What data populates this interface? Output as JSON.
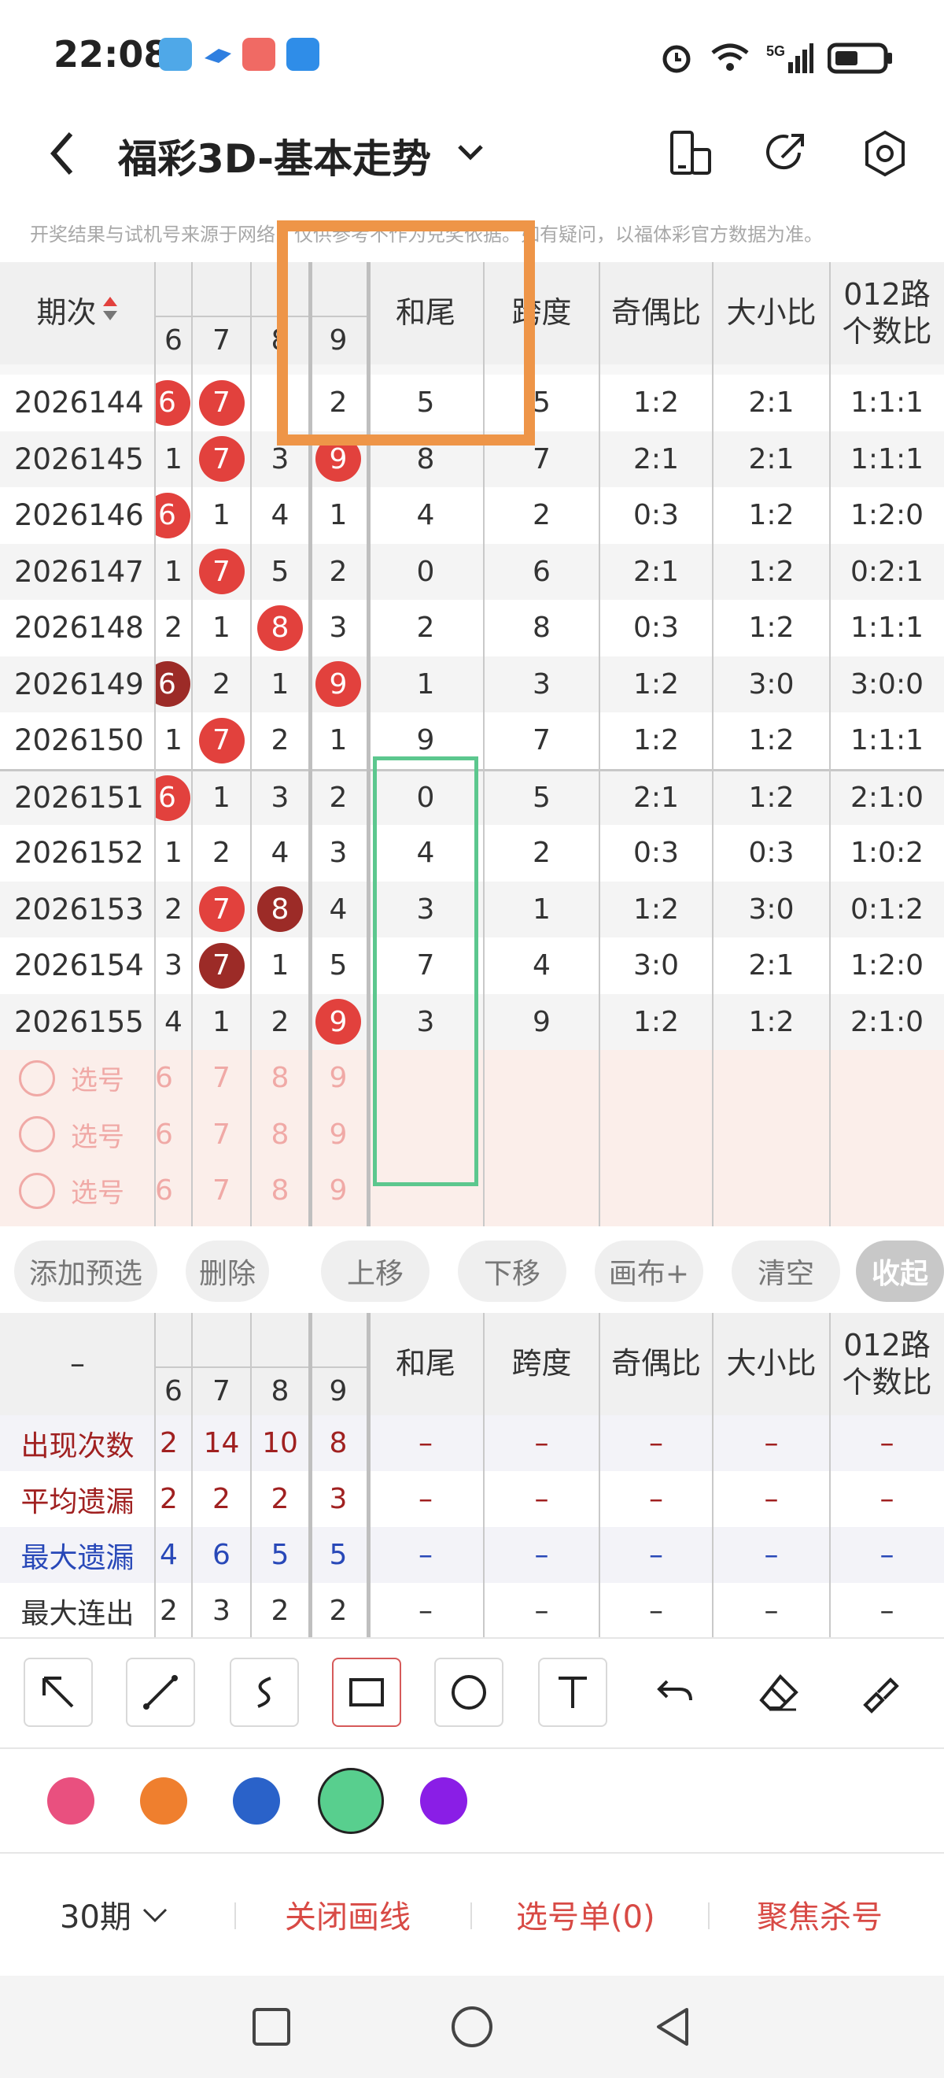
{
  "status": {
    "time": "22:08"
  },
  "header": {
    "title": "福彩3D-基本走势"
  },
  "notice": "开奖结果与试机号来源于网络，仅供参考不作为兑奖依据。如有疑问，以福体彩官方数据为准。",
  "table": {
    "period_label": "期次",
    "digit_labels": [
      "6",
      "7",
      "8",
      "9"
    ],
    "columns": [
      "和尾",
      "跨度",
      "奇偶比",
      "大小比"
    ],
    "route_label": [
      "012路",
      "个数比"
    ],
    "rows": [
      {
        "period": "2026144",
        "d": [
          "6",
          "7",
          "",
          "2"
        ],
        "hw": "5",
        "kd": "5",
        "jo": "1:2",
        "dx": "2:1",
        "lu": "1:1:1"
      },
      {
        "period": "2026145",
        "d": [
          "1",
          "7",
          "3",
          "9"
        ],
        "hw": "8",
        "kd": "7",
        "jo": "2:1",
        "dx": "2:1",
        "lu": "1:1:1"
      },
      {
        "period": "2026146",
        "d": [
          "6",
          "1",
          "4",
          "1"
        ],
        "hw": "4",
        "kd": "2",
        "jo": "0:3",
        "dx": "1:2",
        "lu": "1:2:0"
      },
      {
        "period": "2026147",
        "d": [
          "1",
          "7",
          "5",
          "2"
        ],
        "hw": "0",
        "kd": "6",
        "jo": "2:1",
        "dx": "1:2",
        "lu": "0:2:1"
      },
      {
        "period": "2026148",
        "d": [
          "2",
          "1",
          "8",
          "3"
        ],
        "hw": "2",
        "kd": "8",
        "jo": "0:3",
        "dx": "1:2",
        "lu": "1:1:1"
      },
      {
        "period": "2026149",
        "d": [
          "6",
          "2",
          "1",
          "9"
        ],
        "hw": "1",
        "kd": "3",
        "jo": "1:2",
        "dx": "3:0",
        "lu": "3:0:0"
      },
      {
        "period": "2026150",
        "d": [
          "1",
          "7",
          "2",
          "1"
        ],
        "hw": "9",
        "kd": "7",
        "jo": "1:2",
        "dx": "1:2",
        "lu": "1:1:1"
      },
      {
        "period": "2026151",
        "d": [
          "6",
          "1",
          "3",
          "2"
        ],
        "hw": "0",
        "kd": "5",
        "jo": "2:1",
        "dx": "1:2",
        "lu": "2:1:0"
      },
      {
        "period": "2026152",
        "d": [
          "1",
          "2",
          "4",
          "3"
        ],
        "hw": "4",
        "kd": "2",
        "jo": "0:3",
        "dx": "0:3",
        "lu": "1:0:2"
      },
      {
        "period": "2026153",
        "d": [
          "2",
          "7",
          "8",
          "4"
        ],
        "hw": "3",
        "kd": "1",
        "jo": "1:2",
        "dx": "3:0",
        "lu": "0:1:2"
      },
      {
        "period": "2026154",
        "d": [
          "3",
          "7",
          "1",
          "5"
        ],
        "hw": "7",
        "kd": "4",
        "jo": "3:0",
        "dx": "2:1",
        "lu": "1:2:0"
      },
      {
        "period": "2026155",
        "d": [
          "4",
          "1",
          "2",
          "9"
        ],
        "hw": "3",
        "kd": "9",
        "jo": "1:2",
        "dx": "1:2",
        "lu": "2:1:0"
      }
    ],
    "pick_label": "选号",
    "pick_digits": [
      "6",
      "7",
      "8",
      "9"
    ]
  },
  "actions": [
    "添加预选",
    "删除",
    "上移",
    "下移",
    "画布+",
    "清空",
    "收起"
  ],
  "stats": {
    "dash": "–",
    "rows": [
      {
        "label": "出现次数",
        "vals": [
          "2",
          "14",
          "10",
          "8"
        ],
        "color": "#a02020"
      },
      {
        "label": "平均遗漏",
        "vals": [
          "2",
          "2",
          "2",
          "3"
        ],
        "color": "#a02020"
      },
      {
        "label": "最大遗漏",
        "vals": [
          "4",
          "6",
          "5",
          "5"
        ],
        "color": "#2848b8"
      },
      {
        "label": "最大连出",
        "vals": [
          "2",
          "3",
          "2",
          "2"
        ],
        "color": "#333333"
      }
    ]
  },
  "colors": {
    "swatches": [
      "#e9507f",
      "#ef7f2e",
      "#2a62c9",
      "#58cf8e",
      "#8a1ee6"
    ],
    "orange_box": "#ee9548",
    "green_box": "#5cc78e"
  },
  "bottom": {
    "periods": "30期",
    "close_draw": "关闭画线",
    "pick_list": "选号单(0)",
    "focus_kill": "聚焦杀号"
  }
}
